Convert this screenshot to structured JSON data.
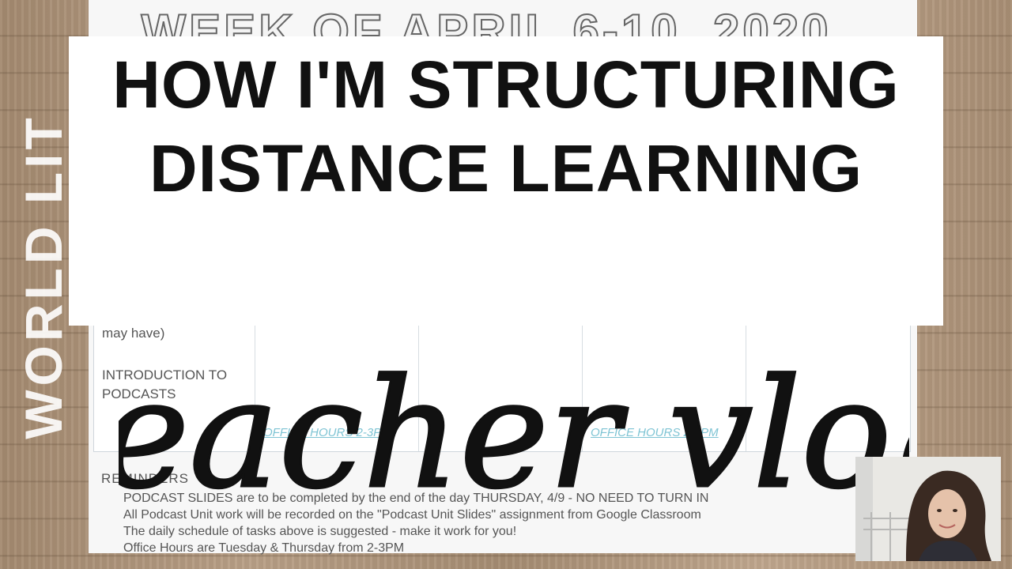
{
  "document": {
    "title": "WEEK OF APRIL 6-10, 2020",
    "cell_partial_text": "may have)",
    "cell_topic": "INTRODUCTION TO PODCASTS",
    "office_hours": [
      "OFFICE HOURS 2-3PM",
      "OFFICE HOURS 2-3PM"
    ],
    "reminders_heading": "REMINDERS",
    "reminders": [
      "PODCAST SLIDES are to be completed by the end of the day THURSDAY, 4/9 - NO NEED TO TURN IN",
      "All Podcast Unit work will be recorded on the \"Podcast Unit Slides\" assignment from Google Classroom",
      "The daily schedule of tasks above is suggested - make it work for you!",
      "Office Hours are Tuesday & Thursday from 2-3PM"
    ]
  },
  "side_label": "WORLD LIT",
  "headline": "HOW I'M STRUCTURING DISTANCE LEARNING",
  "script_text": "teacher vlog",
  "colors": {
    "wood": "#b09579",
    "banner": "#ffffff",
    "headline": "#111111",
    "link": "#7fc4d4"
  }
}
